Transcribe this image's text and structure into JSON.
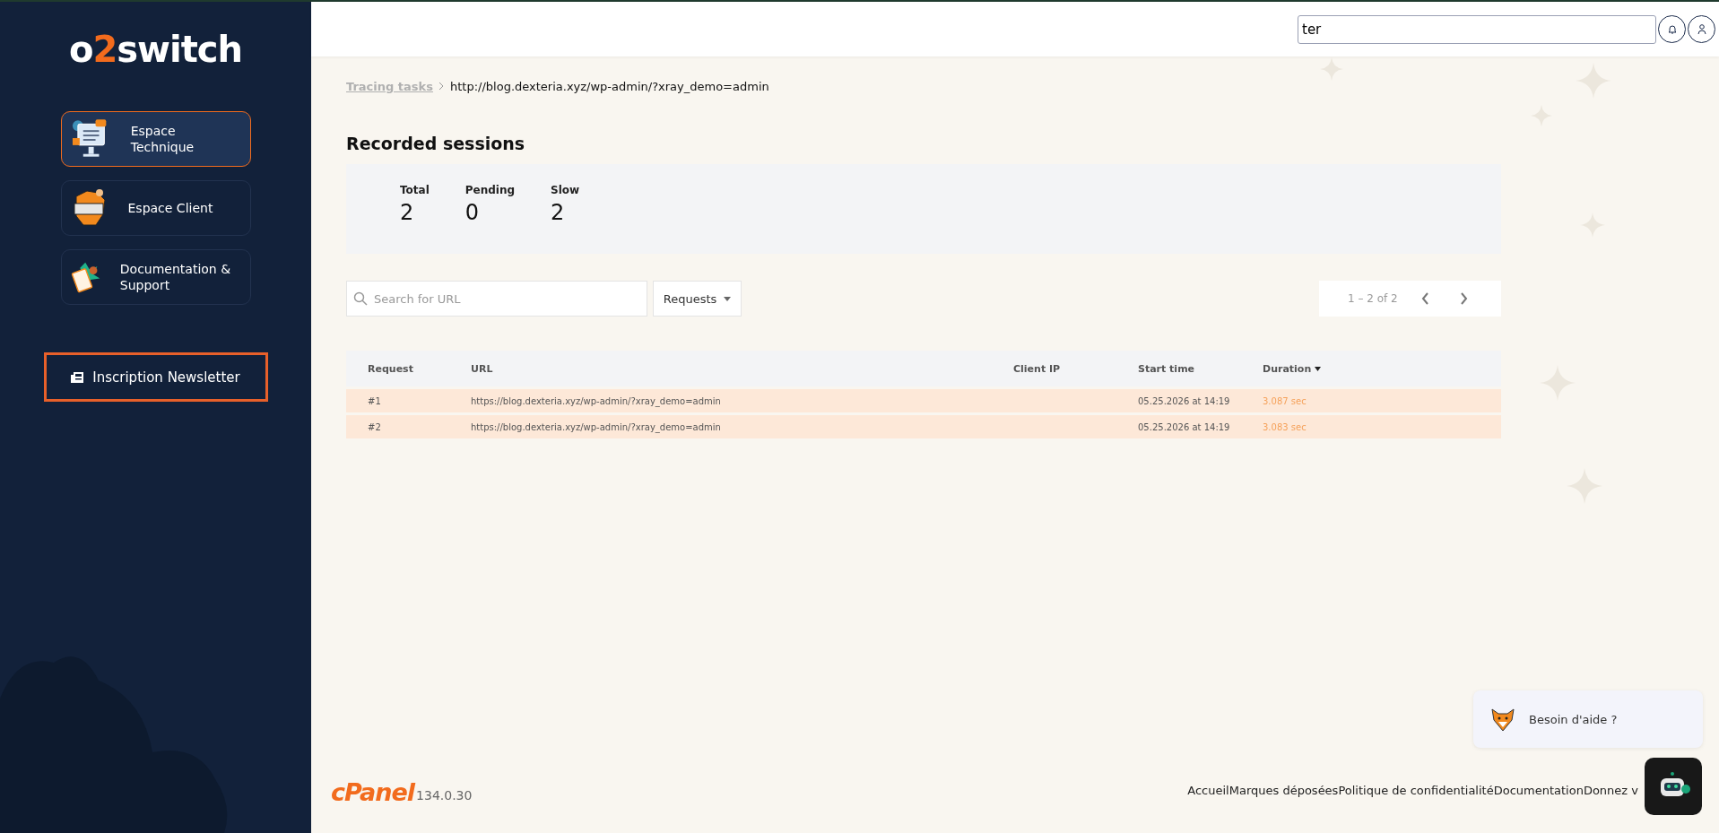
{
  "sidebar": {
    "logo": {
      "before": "o",
      "accent": "2",
      "after": "switch"
    },
    "nav": [
      {
        "label": "Espace Technique",
        "selected": true,
        "kind": "monitor"
      },
      {
        "label": "Espace Client",
        "selected": false,
        "kind": "chip"
      },
      {
        "label": "Documentation & Support",
        "selected": false,
        "kind": "clipboard"
      }
    ],
    "newsletter": "Inscription Newsletter"
  },
  "topbar": {
    "search_value": "ter"
  },
  "breadcrumb": {
    "link": "Tracing tasks",
    "current": "http://blog.dexteria.xyz/wp-admin/?xray_demo=admin"
  },
  "title": "Recorded sessions",
  "stats": [
    {
      "label": "Total",
      "value": "2"
    },
    {
      "label": "Pending",
      "value": "0"
    },
    {
      "label": "Slow",
      "value": "2"
    }
  ],
  "toolbar": {
    "search_placeholder": "Search for URL",
    "filter": "Requests",
    "pagination": "1 – 2 of 2"
  },
  "table": {
    "columns": [
      {
        "label": "Request",
        "sorted": false
      },
      {
        "label": "URL",
        "sorted": false
      },
      {
        "label": "Client IP",
        "sorted": false
      },
      {
        "label": "Start time",
        "sorted": false
      },
      {
        "label": "Duration",
        "sorted": true
      }
    ],
    "rows": [
      {
        "request": "#1",
        "url": "https://blog.dexteria.xyz/wp-admin/?xray_demo=admin",
        "client_ip": "",
        "start": "05.25.2026 at 14:19",
        "duration": "3.087 sec",
        "slow": true
      },
      {
        "request": "#2",
        "url": "https://blog.dexteria.xyz/wp-admin/?xray_demo=admin",
        "client_ip": "",
        "start": "05.25.2026 at 14:19",
        "duration": "3.083 sec",
        "slow": true
      }
    ]
  },
  "footer": {
    "brand": "cPanel",
    "version": "134.0.30",
    "links": [
      "Accueil",
      "Marques déposées",
      "Politique de confidentialité",
      "Documentation",
      "Donnez v"
    ]
  },
  "help": {
    "label": "Besoin d'aide ?"
  }
}
